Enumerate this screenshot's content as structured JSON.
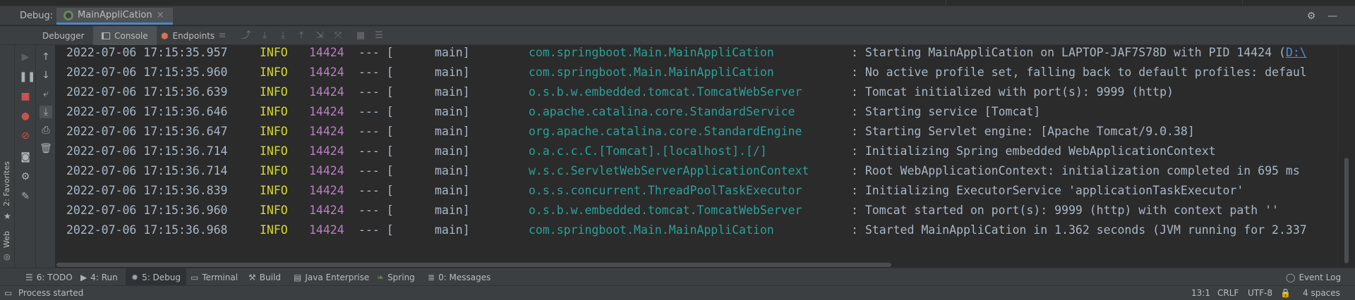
{
  "debug_bar": {
    "title": "Debug:",
    "session_tab": "MainAppliCation",
    "close_glyph": "×"
  },
  "toolbar": {
    "tabs": [
      {
        "label": "Debugger",
        "icon": "debugger-icon"
      },
      {
        "label": "Console",
        "icon": "console-icon",
        "active": true
      },
      {
        "label": "Endpoints",
        "icon": "endpoints-icon"
      }
    ]
  },
  "sidebar": {
    "favorites_label": "2: Favorites",
    "web_label": "Web"
  },
  "console": {
    "lines": [
      {
        "date": "2022-07-06 17:15:35.957",
        "level": "INFO",
        "pid": "14424",
        "sep": "--- [",
        "thread": "main]",
        "logger": "com.springboot.Main.MainAppliCation",
        "message": ": Starting MainAppliCation on LAPTOP-JAF7S78D with PID 14424 (",
        "link": "D:\\"
      },
      {
        "date": "2022-07-06 17:15:35.960",
        "level": "INFO",
        "pid": "14424",
        "sep": "--- [",
        "thread": "main]",
        "logger": "com.springboot.Main.MainAppliCation",
        "message": ": No active profile set, falling back to default profiles: defaul"
      },
      {
        "date": "2022-07-06 17:15:36.639",
        "level": "INFO",
        "pid": "14424",
        "sep": "--- [",
        "thread": "main]",
        "logger": "o.s.b.w.embedded.tomcat.TomcatWebServer",
        "message": ": Tomcat initialized with port(s): 9999 (http)"
      },
      {
        "date": "2022-07-06 17:15:36.646",
        "level": "INFO",
        "pid": "14424",
        "sep": "--- [",
        "thread": "main]",
        "logger": "o.apache.catalina.core.StandardService",
        "message": ": Starting service [Tomcat]"
      },
      {
        "date": "2022-07-06 17:15:36.647",
        "level": "INFO",
        "pid": "14424",
        "sep": "--- [",
        "thread": "main]",
        "logger": "org.apache.catalina.core.StandardEngine",
        "message": ": Starting Servlet engine: [Apache Tomcat/9.0.38]"
      },
      {
        "date": "2022-07-06 17:15:36.714",
        "level": "INFO",
        "pid": "14424",
        "sep": "--- [",
        "thread": "main]",
        "logger": "o.a.c.c.C.[Tomcat].[localhost].[/]",
        "message": ": Initializing Spring embedded WebApplicationContext"
      },
      {
        "date": "2022-07-06 17:15:36.714",
        "level": "INFO",
        "pid": "14424",
        "sep": "--- [",
        "thread": "main]",
        "logger": "w.s.c.ServletWebServerApplicationContext",
        "message": ": Root WebApplicationContext: initialization completed in 695 ms"
      },
      {
        "date": "2022-07-06 17:15:36.839",
        "level": "INFO",
        "pid": "14424",
        "sep": "--- [",
        "thread": "main]",
        "logger": "o.s.s.concurrent.ThreadPoolTaskExecutor",
        "message": ": Initializing ExecutorService 'applicationTaskExecutor'"
      },
      {
        "date": "2022-07-06 17:15:36.960",
        "level": "INFO",
        "pid": "14424",
        "sep": "--- [",
        "thread": "main]",
        "logger": "o.s.b.w.embedded.tomcat.TomcatWebServer",
        "message": ": Tomcat started on port(s): 9999 (http) with context path ''"
      },
      {
        "date": "2022-07-06 17:15:36.968",
        "level": "INFO",
        "pid": "14424",
        "sep": "--- [",
        "thread": "main]",
        "logger": "com.springboot.Main.MainAppliCation",
        "message": ": Started MainAppliCation in 1.362 seconds (JVM running for 2.337"
      }
    ]
  },
  "tool_tabs": [
    {
      "label": "6: TODO",
      "icon": "list-icon"
    },
    {
      "label": "4: Run",
      "icon": "run-icon"
    },
    {
      "label": "5: Debug",
      "icon": "debug-icon",
      "active": true
    },
    {
      "label": "Terminal",
      "icon": "terminal-icon"
    },
    {
      "label": "Build",
      "icon": "build-icon"
    },
    {
      "label": "Java Enterprise",
      "icon": "java-enterprise-icon"
    },
    {
      "label": "Spring",
      "icon": "spring-icon"
    },
    {
      "label": "0: Messages",
      "icon": "messages-icon"
    }
  ],
  "event_log": "Event Log",
  "status": {
    "text": "Process started",
    "position": "13:1",
    "line_separator": "CRLF",
    "encoding": "UTF-8",
    "indent": "4 spaces"
  },
  "colors": {
    "log_level": "#d3d92b",
    "pid": "#b87fc2",
    "logger": "#2aa198",
    "text": "#a9b7c6",
    "accent": "#4a88c7"
  }
}
